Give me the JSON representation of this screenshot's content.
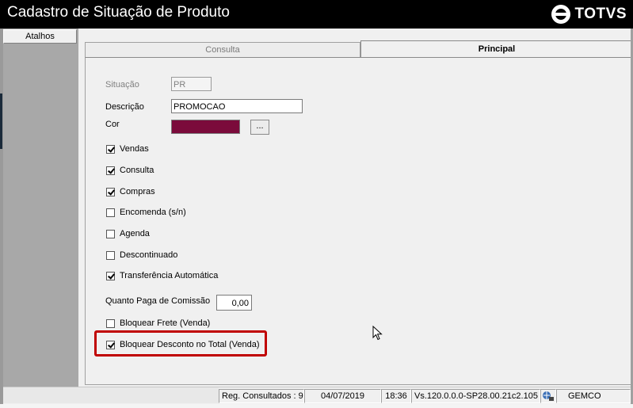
{
  "window": {
    "title": "Cadastro de Situação de Produto",
    "brand": "TOTVS"
  },
  "sidebar": {
    "atalhos_label": "Atalhos"
  },
  "tabs": [
    {
      "label": "Consulta",
      "active": false
    },
    {
      "label": "Principal",
      "active": true
    }
  ],
  "form": {
    "situacao_label": "Situação",
    "situacao_value": "PR",
    "descricao_label": "Descrição",
    "descricao_value": "PROMOCAO",
    "cor_label": "Cor",
    "cor_color": "#7b0b3b",
    "cor_button_label": "...",
    "checkboxes": [
      {
        "label": "Vendas",
        "checked": true
      },
      {
        "label": "Consulta",
        "checked": true
      },
      {
        "label": "Compras",
        "checked": true
      },
      {
        "label": "Encomenda (s/n)",
        "checked": false
      },
      {
        "label": "Agenda",
        "checked": false
      },
      {
        "label": "Descontinuado",
        "checked": false
      },
      {
        "label": "Transferência Automática",
        "checked": true
      }
    ],
    "comissao_label": "Quanto Paga de Comissão",
    "comissao_value": "0,00",
    "bloquear_frete_label": "Bloquear Frete (Venda)",
    "bloquear_frete_checked": false,
    "bloquear_desconto_label": "Bloquear Desconto no Total (Venda)",
    "bloquear_desconto_checked": true
  },
  "statusbar": {
    "reg_consultados": "Reg. Consultados : 9",
    "date": "04/07/2019",
    "time": "18:36",
    "version": "Vs.120.0.0.0-SP28.00.21c2.105",
    "system": "GEMCO"
  },
  "colors": {
    "titlebar": "#000000",
    "highlight": "#c00000",
    "sidebar": "#a8a8a8"
  }
}
